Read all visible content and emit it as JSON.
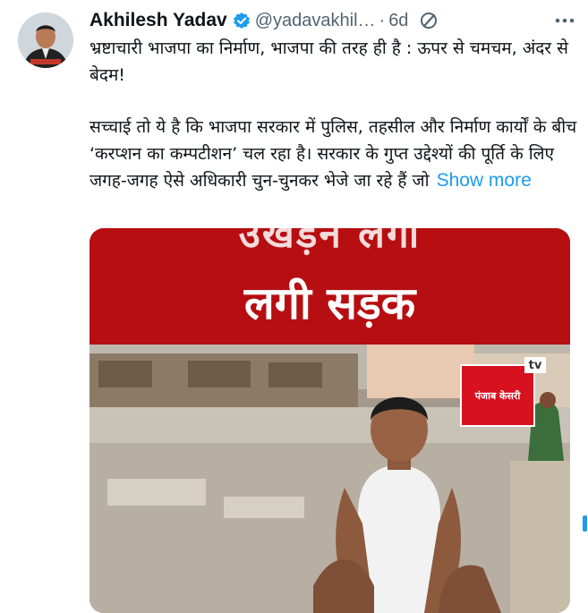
{
  "tweet": {
    "author_name": "Akhilesh Yadav",
    "handle": "@yadavakhil…",
    "separator": "·",
    "time": "6d",
    "verified_icon": "verified-badge-icon",
    "edited_icon": "edited-pencil-icon",
    "more_icon": "more-options-icon",
    "paragraph1": "भ्रष्टाचारी भाजपा का निर्माण,  भाजपा की तरह ही है : ऊपर से चमचम, अंदर से बेदम!",
    "paragraph2": "सच्चाई तो ये है कि भाजपा सरकार में पुलिस, तहसील और निर्माण कार्यों के बीच ‘करप्शन का कम्पटीशन’ चल रहा है। सरकार के गुप्त उद्देश्यों की पूर्ति के लिए जगह-जगह ऐसे अधिकारी चुन-चुनकर भेजे जा रहे हैं जो",
    "show_more": "Show more"
  },
  "media": {
    "banner_top_text": "उखड़ने लगी",
    "banner_main_text": "लगी सड़क",
    "logo_text": "पंजाब केसरी",
    "logo_tv": "tv",
    "banner_color": "#b70e11"
  },
  "colors": {
    "link": "#1d9bf0",
    "secondary_text": "#536471",
    "primary_text": "#0f1419"
  }
}
